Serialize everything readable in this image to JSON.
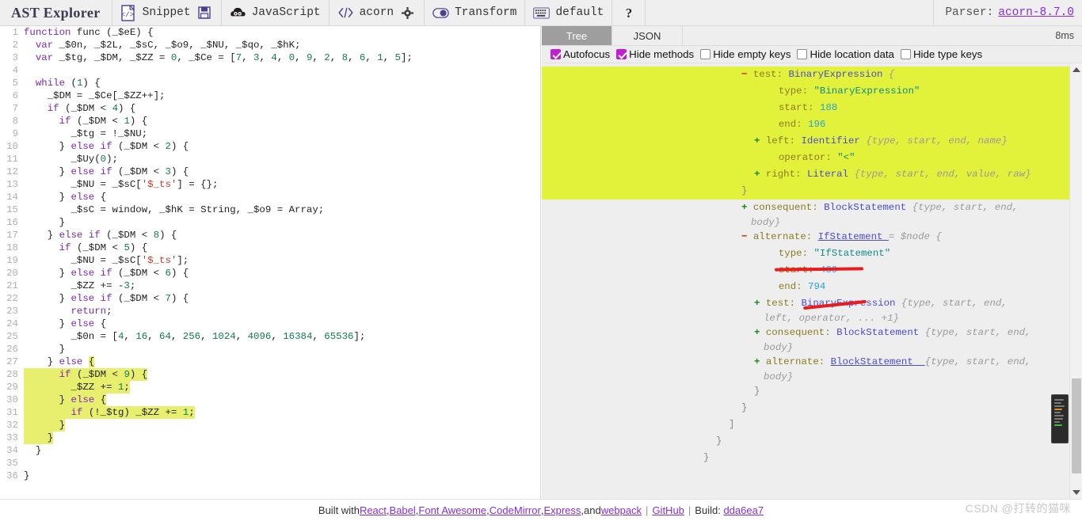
{
  "header": {
    "brand": "AST Explorer",
    "groups": [
      {
        "icon": "code-file-icon",
        "label": "Snippet",
        "trailing_icon": "save-icon"
      },
      {
        "icon": "acorn-cloud-icon",
        "label": "JavaScript",
        "trailing_icon": null
      },
      {
        "icon": "angle-brackets-icon",
        "label": "acorn",
        "trailing_icon": "gear-icon"
      },
      {
        "icon": "toggle-icon",
        "label": "Transform",
        "trailing_icon": null
      },
      {
        "icon": "keyboard-icon",
        "label": "default",
        "trailing_icon": null
      },
      {
        "icon": "question-mark-icon",
        "label": "",
        "trailing_icon": null
      }
    ],
    "parser_label": "Parser:",
    "parser_version": "acorn-8.7.0"
  },
  "editor": {
    "lines": [
      {
        "n": 1,
        "highlight": false,
        "tokens": [
          {
            "t": "function ",
            "c": "k"
          },
          {
            "t": "func ",
            "c": "pl"
          },
          {
            "t": "(_$eE) {",
            "c": "pl"
          }
        ]
      },
      {
        "n": 2,
        "highlight": false,
        "tokens": [
          {
            "t": "  ",
            "c": "pl"
          },
          {
            "t": "var ",
            "c": "k"
          },
          {
            "t": "_$0n, _$2L, _$sC, _$o9, _$NU, _$qo, _$hK;",
            "c": "pl"
          }
        ]
      },
      {
        "n": 3,
        "highlight": false,
        "tokens": [
          {
            "t": "  ",
            "c": "pl"
          },
          {
            "t": "var ",
            "c": "k"
          },
          {
            "t": "_$tg, _$DM, _$ZZ = ",
            "c": "pl"
          },
          {
            "t": "0",
            "c": "num"
          },
          {
            "t": ", _$Ce = [",
            "c": "pl"
          },
          {
            "t": "7",
            "c": "num"
          },
          {
            "t": ", ",
            "c": "pl"
          },
          {
            "t": "3",
            "c": "num"
          },
          {
            "t": ", ",
            "c": "pl"
          },
          {
            "t": "4",
            "c": "num"
          },
          {
            "t": ", ",
            "c": "pl"
          },
          {
            "t": "0",
            "c": "num"
          },
          {
            "t": ", ",
            "c": "pl"
          },
          {
            "t": "9",
            "c": "num"
          },
          {
            "t": ", ",
            "c": "pl"
          },
          {
            "t": "2",
            "c": "num"
          },
          {
            "t": ", ",
            "c": "pl"
          },
          {
            "t": "8",
            "c": "num"
          },
          {
            "t": ", ",
            "c": "pl"
          },
          {
            "t": "6",
            "c": "num"
          },
          {
            "t": ", ",
            "c": "pl"
          },
          {
            "t": "1",
            "c": "num"
          },
          {
            "t": ", ",
            "c": "pl"
          },
          {
            "t": "5",
            "c": "num"
          },
          {
            "t": "];",
            "c": "pl"
          }
        ]
      },
      {
        "n": 4,
        "highlight": false,
        "tokens": []
      },
      {
        "n": 5,
        "highlight": false,
        "tokens": [
          {
            "t": "  ",
            "c": "pl"
          },
          {
            "t": "while ",
            "c": "k"
          },
          {
            "t": "(",
            "c": "pl"
          },
          {
            "t": "1",
            "c": "num"
          },
          {
            "t": ") {",
            "c": "pl"
          }
        ]
      },
      {
        "n": 6,
        "highlight": false,
        "tokens": [
          {
            "t": "    _$DM = _$Ce[_$ZZ++];",
            "c": "pl"
          }
        ]
      },
      {
        "n": 7,
        "highlight": false,
        "tokens": [
          {
            "t": "    ",
            "c": "pl"
          },
          {
            "t": "if ",
            "c": "k"
          },
          {
            "t": "(_$DM < ",
            "c": "pl"
          },
          {
            "t": "4",
            "c": "num"
          },
          {
            "t": ") {",
            "c": "pl"
          }
        ]
      },
      {
        "n": 8,
        "highlight": false,
        "tokens": [
          {
            "t": "      ",
            "c": "pl"
          },
          {
            "t": "if ",
            "c": "k"
          },
          {
            "t": "(_$DM < ",
            "c": "pl"
          },
          {
            "t": "1",
            "c": "num"
          },
          {
            "t": ") {",
            "c": "pl"
          }
        ]
      },
      {
        "n": 9,
        "highlight": false,
        "tokens": [
          {
            "t": "        _$tg = !_$NU;",
            "c": "pl"
          }
        ]
      },
      {
        "n": 10,
        "highlight": false,
        "tokens": [
          {
            "t": "      } ",
            "c": "pl"
          },
          {
            "t": "else if ",
            "c": "k"
          },
          {
            "t": "(_$DM < ",
            "c": "pl"
          },
          {
            "t": "2",
            "c": "num"
          },
          {
            "t": ") {",
            "c": "pl"
          }
        ]
      },
      {
        "n": 11,
        "highlight": false,
        "tokens": [
          {
            "t": "        _$Uy(",
            "c": "pl"
          },
          {
            "t": "0",
            "c": "num"
          },
          {
            "t": ");",
            "c": "pl"
          }
        ]
      },
      {
        "n": 12,
        "highlight": false,
        "tokens": [
          {
            "t": "      } ",
            "c": "pl"
          },
          {
            "t": "else if ",
            "c": "k"
          },
          {
            "t": "(_$DM < ",
            "c": "pl"
          },
          {
            "t": "3",
            "c": "num"
          },
          {
            "t": ") {",
            "c": "pl"
          }
        ]
      },
      {
        "n": 13,
        "highlight": false,
        "tokens": [
          {
            "t": "        _$NU = _$sC[",
            "c": "pl"
          },
          {
            "t": "'$_ts'",
            "c": "str"
          },
          {
            "t": "] = {};",
            "c": "pl"
          }
        ]
      },
      {
        "n": 14,
        "highlight": false,
        "tokens": [
          {
            "t": "      } ",
            "c": "pl"
          },
          {
            "t": "else ",
            "c": "k"
          },
          {
            "t": "{",
            "c": "pl"
          }
        ]
      },
      {
        "n": 15,
        "highlight": false,
        "tokens": [
          {
            "t": "        _$sC = window, _$hK = String, _$o9 = Array;",
            "c": "pl"
          }
        ]
      },
      {
        "n": 16,
        "highlight": false,
        "tokens": [
          {
            "t": "      }",
            "c": "pl"
          }
        ]
      },
      {
        "n": 17,
        "highlight": false,
        "tokens": [
          {
            "t": "    } ",
            "c": "pl"
          },
          {
            "t": "else if ",
            "c": "k"
          },
          {
            "t": "(_$DM < ",
            "c": "pl"
          },
          {
            "t": "8",
            "c": "num"
          },
          {
            "t": ") {",
            "c": "pl"
          }
        ]
      },
      {
        "n": 18,
        "highlight": false,
        "tokens": [
          {
            "t": "      ",
            "c": "pl"
          },
          {
            "t": "if ",
            "c": "k"
          },
          {
            "t": "(_$DM < ",
            "c": "pl"
          },
          {
            "t": "5",
            "c": "num"
          },
          {
            "t": ") {",
            "c": "pl"
          }
        ]
      },
      {
        "n": 19,
        "highlight": false,
        "tokens": [
          {
            "t": "        _$NU = _$sC[",
            "c": "pl"
          },
          {
            "t": "'$_ts'",
            "c": "str"
          },
          {
            "t": "];",
            "c": "pl"
          }
        ]
      },
      {
        "n": 20,
        "highlight": false,
        "tokens": [
          {
            "t": "      } ",
            "c": "pl"
          },
          {
            "t": "else if ",
            "c": "k"
          },
          {
            "t": "(_$DM < ",
            "c": "pl"
          },
          {
            "t": "6",
            "c": "num"
          },
          {
            "t": ") {",
            "c": "pl"
          }
        ]
      },
      {
        "n": 21,
        "highlight": false,
        "tokens": [
          {
            "t": "        _$ZZ += -",
            "c": "pl"
          },
          {
            "t": "3",
            "c": "num"
          },
          {
            "t": ";",
            "c": "pl"
          }
        ]
      },
      {
        "n": 22,
        "highlight": false,
        "tokens": [
          {
            "t": "      } ",
            "c": "pl"
          },
          {
            "t": "else if ",
            "c": "k"
          },
          {
            "t": "(_$DM < ",
            "c": "pl"
          },
          {
            "t": "7",
            "c": "num"
          },
          {
            "t": ") {",
            "c": "pl"
          }
        ]
      },
      {
        "n": 23,
        "highlight": false,
        "tokens": [
          {
            "t": "        ",
            "c": "pl"
          },
          {
            "t": "return",
            "c": "k"
          },
          {
            "t": ";",
            "c": "pl"
          }
        ]
      },
      {
        "n": 24,
        "highlight": false,
        "tokens": [
          {
            "t": "      } ",
            "c": "pl"
          },
          {
            "t": "else ",
            "c": "k"
          },
          {
            "t": "{",
            "c": "pl"
          }
        ]
      },
      {
        "n": 25,
        "highlight": false,
        "tokens": [
          {
            "t": "        _$0n = [",
            "c": "pl"
          },
          {
            "t": "4",
            "c": "num"
          },
          {
            "t": ", ",
            "c": "pl"
          },
          {
            "t": "16",
            "c": "num"
          },
          {
            "t": ", ",
            "c": "pl"
          },
          {
            "t": "64",
            "c": "num"
          },
          {
            "t": ", ",
            "c": "pl"
          },
          {
            "t": "256",
            "c": "num"
          },
          {
            "t": ", ",
            "c": "pl"
          },
          {
            "t": "1024",
            "c": "num"
          },
          {
            "t": ", ",
            "c": "pl"
          },
          {
            "t": "4096",
            "c": "num"
          },
          {
            "t": ", ",
            "c": "pl"
          },
          {
            "t": "16384",
            "c": "num"
          },
          {
            "t": ", ",
            "c": "pl"
          },
          {
            "t": "65536",
            "c": "num"
          },
          {
            "t": "];",
            "c": "pl"
          }
        ]
      },
      {
        "n": 26,
        "highlight": false,
        "tokens": [
          {
            "t": "      }",
            "c": "pl"
          }
        ]
      },
      {
        "n": 27,
        "highlight": false,
        "tokens": [
          {
            "t": "    } ",
            "c": "pl"
          },
          {
            "t": "else ",
            "c": "k"
          },
          {
            "t": "{",
            "c": "pl",
            "hl": true
          }
        ]
      },
      {
        "n": 28,
        "highlight": true,
        "hl_start": 0,
        "tokens": [
          {
            "t": "      ",
            "c": "pl"
          },
          {
            "t": "if ",
            "c": "k"
          },
          {
            "t": "(_$DM < ",
            "c": "pl"
          },
          {
            "t": "9",
            "c": "num"
          },
          {
            "t": ") {",
            "c": "pl"
          }
        ]
      },
      {
        "n": 29,
        "highlight": true,
        "hl_start": 0,
        "tokens": [
          {
            "t": "        _$ZZ += ",
            "c": "pl"
          },
          {
            "t": "1",
            "c": "num"
          },
          {
            "t": ";",
            "c": "pl"
          }
        ]
      },
      {
        "n": 30,
        "highlight": true,
        "hl_start": 0,
        "tokens": [
          {
            "t": "      } ",
            "c": "pl"
          },
          {
            "t": "else ",
            "c": "k"
          },
          {
            "t": "{",
            "c": "pl"
          }
        ]
      },
      {
        "n": 31,
        "highlight": true,
        "hl_start": 0,
        "tokens": [
          {
            "t": "        ",
            "c": "pl"
          },
          {
            "t": "if ",
            "c": "k"
          },
          {
            "t": "(!_$tg) _$ZZ += ",
            "c": "pl"
          },
          {
            "t": "1",
            "c": "num"
          },
          {
            "t": ";",
            "c": "pl"
          }
        ]
      },
      {
        "n": 32,
        "highlight": true,
        "hl_start": 0,
        "tokens": [
          {
            "t": "      }",
            "c": "pl"
          }
        ]
      },
      {
        "n": 33,
        "highlight": true,
        "hl_start": 0,
        "tokens": [
          {
            "t": "    }",
            "c": "pl"
          }
        ]
      },
      {
        "n": 34,
        "highlight": false,
        "tokens": [
          {
            "t": "  }",
            "c": "pl"
          }
        ]
      },
      {
        "n": 35,
        "highlight": false,
        "tokens": []
      },
      {
        "n": 36,
        "highlight": false,
        "tokens": [
          {
            "t": "}",
            "c": "pl"
          }
        ]
      }
    ]
  },
  "right_panel": {
    "tabs": [
      {
        "label": "Tree",
        "active": true
      },
      {
        "label": "JSON",
        "active": false
      }
    ],
    "timing": "8ms",
    "options": [
      {
        "label": "Autofocus",
        "checked": true
      },
      {
        "label": "Hide methods",
        "checked": true
      },
      {
        "label": "Hide empty keys",
        "checked": false
      },
      {
        "label": "Hide location data",
        "checked": false
      },
      {
        "label": "Hide type keys",
        "checked": false
      }
    ],
    "tree_rows": [
      {
        "indent": 1,
        "toggle": "minus",
        "key": "test:",
        "type": "BinaryExpression",
        "hint": "{",
        "highlight": true
      },
      {
        "indent": 3,
        "toggle": "",
        "key": "type:",
        "typestr": "\"BinaryExpression\"",
        "highlight": true
      },
      {
        "indent": 3,
        "toggle": "",
        "key": "start:",
        "numv": "188",
        "highlight": true
      },
      {
        "indent": 3,
        "toggle": "",
        "key": "end:",
        "numv": "196",
        "highlight": true
      },
      {
        "indent": 2,
        "toggle": "plus",
        "key": "left:",
        "type": "Identifier",
        "hint": "{type, start, end, name}",
        "highlight": true
      },
      {
        "indent": 3,
        "toggle": "",
        "key": "operator:",
        "typestr": "\"<\"",
        "highlight": true
      },
      {
        "indent": 2,
        "toggle": "plus",
        "key": "right:",
        "type": "Literal",
        "hint": "{type, start, end, value, raw}",
        "highlight": true
      },
      {
        "indent": 1,
        "toggle": "",
        "key": "}",
        "brace": true,
        "highlight": true
      },
      {
        "indent": 1,
        "toggle": "plus",
        "key": "consequent:",
        "type": "BlockStatement",
        "hint": "{type, start, end,",
        "hint2": "body}",
        "underline_red": true
      },
      {
        "indent": 1,
        "toggle": "minus",
        "key": "alternate:",
        "type": "IfStatement",
        "noderef": "= $node",
        "hint": "{",
        "underline_red": true,
        "type_underlined": true
      },
      {
        "indent": 3,
        "toggle": "",
        "key": "type:",
        "typestr": "\"IfStatement\""
      },
      {
        "indent": 3,
        "toggle": "",
        "key": "start:",
        "numv": "439"
      },
      {
        "indent": 3,
        "toggle": "",
        "key": "end:",
        "numv": "794"
      },
      {
        "indent": 2,
        "toggle": "plus",
        "key": "test:",
        "type": "BinaryExpression",
        "hint": "{type, start, end,",
        "hint2": "left, operator, ... +1}"
      },
      {
        "indent": 2,
        "toggle": "plus",
        "key": "consequent:",
        "type": "BlockStatement",
        "hint": "{type, start, end,",
        "hint2": "body}"
      },
      {
        "indent": 2,
        "toggle": "plus",
        "key": "alternate:",
        "type": "BlockStatement ",
        "hint": "{type, start, end,",
        "hint2": "body}",
        "type_underlined": true
      },
      {
        "indent": 2,
        "toggle": "",
        "key": "}",
        "brace": true
      },
      {
        "indent": 1,
        "toggle": "",
        "key": "}",
        "brace": true
      },
      {
        "indent": 0,
        "toggle": "",
        "key": "]",
        "brace": true
      },
      {
        "indent": -1,
        "toggle": "",
        "key": "}",
        "brace": true
      },
      {
        "indent": -2,
        "toggle": "",
        "key": "}",
        "brace": true
      }
    ]
  },
  "footer": {
    "prefix": "Built with ",
    "links": [
      "React",
      "Babel",
      "Font Awesome",
      "CodeMirror",
      "Express"
    ],
    "and_text": " and ",
    "webpack": "webpack",
    "github": "GitHub",
    "build_label": "Build:",
    "build_hash": "dda6ea7"
  },
  "watermark": "CSDN @打转的猫咪",
  "colors": {
    "highlight_yellow": "#e2f23a",
    "code_highlight": "#e8ef6e",
    "accent_purple": "#8a2be2",
    "checkbox_on": "#c11fd1",
    "tab_active": "#9e9e9e",
    "annotation_red": "#e81c1c"
  }
}
